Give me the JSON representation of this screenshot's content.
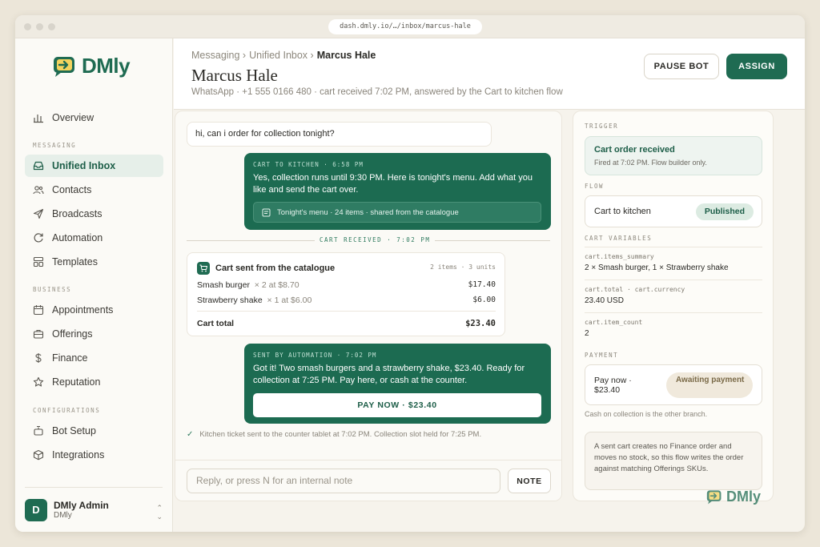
{
  "browser": {
    "url": "dash.dmly.io/…/inbox/marcus-hale"
  },
  "brand": {
    "name": "DMly",
    "accent": "#1f6b52"
  },
  "sidebar": {
    "overview": "Overview",
    "sections": {
      "messaging": "MESSAGING",
      "business": "BUSINESS",
      "configurations": "CONFIGURATIONS"
    },
    "messaging_items": [
      {
        "label": "Unified Inbox",
        "icon": "inbox-icon",
        "active": true
      },
      {
        "label": "Contacts",
        "icon": "contacts-icon"
      },
      {
        "label": "Broadcasts",
        "icon": "send-icon"
      },
      {
        "label": "Automation",
        "icon": "refresh-icon"
      },
      {
        "label": "Templates",
        "icon": "templates-icon"
      }
    ],
    "business_items": [
      {
        "label": "Appointments",
        "icon": "calendar-icon"
      },
      {
        "label": "Offerings",
        "icon": "briefcase-icon"
      },
      {
        "label": "Finance",
        "icon": "dollar-icon"
      },
      {
        "label": "Reputation",
        "icon": "star-icon"
      }
    ],
    "config_items": [
      {
        "label": "Bot Setup",
        "icon": "bot-icon"
      },
      {
        "label": "Integrations",
        "icon": "cube-icon"
      }
    ],
    "user": {
      "initial": "D",
      "name": "DMly Admin",
      "org": "DMly"
    }
  },
  "header": {
    "breadcrumb": [
      "Messaging ›",
      "Unified Inbox ›",
      "Marcus Hale"
    ],
    "title": "Marcus Hale",
    "subtitle": "WhatsApp · +1 555 0166 480 · cart received 7:02 PM, answered by the Cart to kitchen flow",
    "pause_label": "PAUSE BOT",
    "assign_label": "ASSIGN"
  },
  "chat": {
    "incoming": "hi, can i order for collection tonight?",
    "out1": {
      "meta": "CART TO KITCHEN · 6:58 PM",
      "text": "Yes, collection runs until 9:30 PM. Here is tonight's menu. Add what you like and send the cart over.",
      "attachment": "Tonight's menu · 24 items · shared from the catalogue"
    },
    "divider": "CART RECEIVED · 7:02 PM",
    "cart": {
      "title": "Cart sent from the catalogue",
      "meta": "2 items · 3 units",
      "rows": [
        {
          "name": "Smash burger",
          "qty": "× 2 at $8.70",
          "price": "$17.40"
        },
        {
          "name": "Strawberry shake",
          "qty": "× 1 at $6.00",
          "price": "$6.00"
        }
      ],
      "total_label": "Cart total",
      "total_value": "$23.40"
    },
    "out2": {
      "meta": "SENT BY AUTOMATION · 7:02 PM",
      "text": "Got it! Two smash burgers and a strawberry shake, $23.40. Ready for collection at 7:25 PM. Pay here, or cash at the counter.",
      "button": "PAY NOW · $23.40"
    },
    "ticket": "Kitchen ticket sent to the counter tablet at 7:02 PM. Collection slot held for 7:25 PM.",
    "reply_placeholder": "Reply, or press N for an internal note",
    "note_label": "NOTE"
  },
  "panel": {
    "trigger_label": "TRIGGER",
    "trigger_title": "Cart order received",
    "trigger_sub": "Fired at 7:02 PM. Flow builder only.",
    "flow_label": "FLOW",
    "flow_name": "Cart to kitchen",
    "flow_status": "Published",
    "vars_label": "CART VARIABLES",
    "vars": [
      {
        "key": "cart.items_summary",
        "value": "2 × Smash burger, 1 × Strawberry shake"
      },
      {
        "key": "cart.total · cart.currency",
        "value": "23.40 USD"
      },
      {
        "key": "cart.item_count",
        "value": "2"
      }
    ],
    "payment_label": "PAYMENT",
    "payment_amount": "Pay now · $23.40",
    "payment_status": "Awaiting payment",
    "payment_alt": "Cash on collection is the other branch.",
    "info": "A sent cart creates no Finance order and moves no stock, so this flow writes the order against matching Offerings SKUs."
  }
}
